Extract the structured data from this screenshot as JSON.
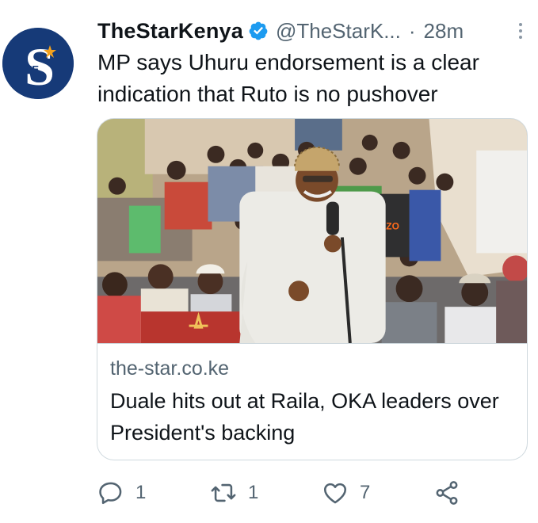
{
  "tweet": {
    "display_name": "TheStarKenya",
    "verified_icon": "verified-badge-icon",
    "handle": "@TheStarK...",
    "separator": "·",
    "time": "28m",
    "text": "MP says Uhuru endorsement is a clear indication that Ruto is no pushover",
    "avatar": {
      "letters": "THE",
      "letter": "S"
    },
    "card": {
      "domain": "the-star.co.ke",
      "title": "Duale hits out at Raila, OKA leaders over President's backing",
      "shirt_text": "AZO"
    },
    "actions": {
      "reply": {
        "icon": "reply-icon",
        "count": "1"
      },
      "retweet": {
        "icon": "retweet-icon",
        "count": "1"
      },
      "like": {
        "icon": "heart-icon",
        "count": "7"
      },
      "share": {
        "icon": "share-icon"
      }
    }
  },
  "colors": {
    "brand_blue": "#1d9bf0",
    "avatar_bg": "#163a78",
    "avatar_accent": "#f4a21d",
    "muted": "#536471"
  }
}
